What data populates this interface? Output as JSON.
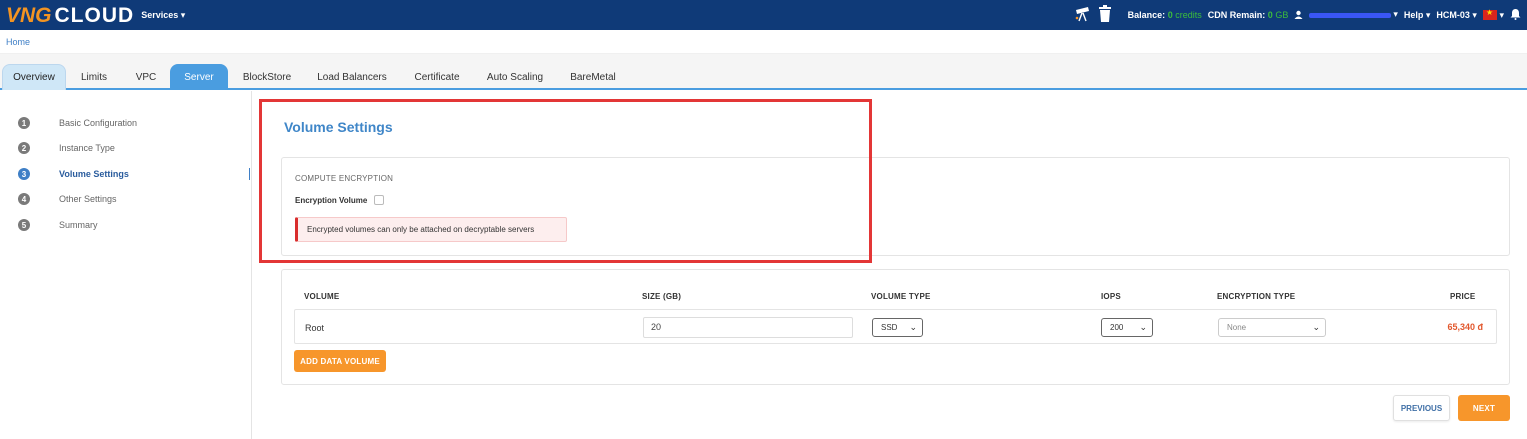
{
  "header": {
    "logo_vng": "VNG",
    "logo_cloud": "CLOUD",
    "services_label": "Services ▾",
    "balance_label": "Balance:",
    "balance_value": "0",
    "balance_unit": "credits",
    "cdn_label": "CDN Remain:",
    "cdn_value": "0",
    "cdn_unit": "GB",
    "user_label": "▾",
    "help_label": "Help ▾",
    "region_label": "HCM-03 ▾",
    "flag_caret": "▾"
  },
  "breadcrumb": {
    "home": "Home"
  },
  "tabs": [
    {
      "label": "Overview"
    },
    {
      "label": "Limits"
    },
    {
      "label": "VPC"
    },
    {
      "label": "Server"
    },
    {
      "label": "BlockStore"
    },
    {
      "label": "Load Balancers"
    },
    {
      "label": "Certificate"
    },
    {
      "label": "Auto Scaling"
    },
    {
      "label": "BareMetal"
    }
  ],
  "steps": [
    {
      "num": "1",
      "label": "Basic Configuration"
    },
    {
      "num": "2",
      "label": "Instance Type"
    },
    {
      "num": "3",
      "label": "Volume Settings"
    },
    {
      "num": "4",
      "label": "Other Settings"
    },
    {
      "num": "5",
      "label": "Summary"
    }
  ],
  "page": {
    "title": "Volume Settings"
  },
  "encryption": {
    "section_title": "COMPUTE ENCRYPTION",
    "checkbox_label": "Encryption Volume",
    "alert_text": "Encrypted volumes can only be attached on decryptable servers"
  },
  "volumes": {
    "headers": [
      "VOLUME",
      "SIZE (GB)",
      "VOLUME TYPE",
      "IOPS",
      "ENCRYPTION TYPE",
      "PRICE"
    ],
    "row": {
      "name": "Root",
      "size": "20",
      "volume_type": "SSD",
      "iops": "200",
      "encryption_type": "None",
      "price": "65,340 đ"
    },
    "add_button": "ADD DATA VOLUME"
  },
  "nav": {
    "previous": "PREVIOUS",
    "next": "NEXT"
  },
  "colors": {
    "header_bg": "#0f3a78",
    "accent_blue": "#4a9de0",
    "orange": "#f7962b",
    "alert_red": "#d92d2d",
    "highlight_red": "#e33636"
  }
}
